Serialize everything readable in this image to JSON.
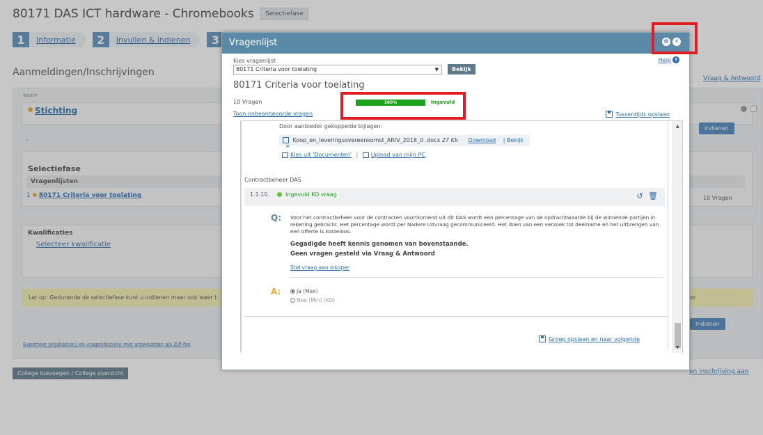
{
  "page": {
    "title": "80171 DAS ICT hardware - Chromebooks",
    "phase_button": "Selectiefase",
    "steps": [
      {
        "num": "1",
        "label": "Informatie"
      },
      {
        "num": "2",
        "label": "Invullen & indienen"
      },
      {
        "num": "3",
        "label": ""
      }
    ],
    "subtitle": "Aanmeldingen/Inschrijvingen",
    "right_link": "Vraag & Antwoord",
    "naam_header": "Naam",
    "org_name": "Stichting",
    "dash": "–",
    "selectiefase_title": "Selectiefase",
    "vragenlijsten_header": "Vragenlijsten",
    "vragenlijst_index": "1",
    "vragenlijst_name": "80171 Criteria voor toelating",
    "vragen_count": "10 Vragen",
    "kwalificaties_header": "Kwalificaties",
    "kwalificatie_link": "Selecteer kwalificatie",
    "note": "Let op: Gedurende de selectiefase kunt u indienen maar ook weer t",
    "note_end": "er.",
    "indienen": "Indienen",
    "export": "Exporteer prijslijst(en) en vragenlijst(en) met antwoorden als ZIP-file",
    "collega_button": "Collega toevoegen / Collega overzicht",
    "bottom_right_link": "en inschrijving aan"
  },
  "modal": {
    "title": "Vragenlijst",
    "help": "Help",
    "kies_label": "Kies vragenlijst",
    "select_value": "80171 Criteria voor toelating",
    "bekijk": "Bekijk",
    "heading": "80171 Criteria voor toelating",
    "vragen": "10 Vragen",
    "progress": {
      "percent": 100,
      "label": "100%"
    },
    "status": "Ingevuld",
    "toon_link": "Toon onbeantwoorde vragen",
    "tussentijds": "Tussentijds opslaan",
    "attachments_label": "Door aanbieder gekoppelde bijlagen:",
    "file_name": "Koop_en_leveringsovereenkomst_ARIV_2018_0 .docx",
    "file_size": "27 Kb",
    "download": "Download",
    "bekijk_link": "| Bekijk",
    "kies_docs": "Kies uit 'Documenten'",
    "sep": "|",
    "upload": "Upload van mijn PC",
    "section": "Contractbeheer DAS",
    "question_num": "1.1.10.",
    "question_status": "Ingevuld",
    "question_type": "KO vraag",
    "q_label": "Q:",
    "q_text": "Voor het contractbeheer voor de contracten voortkomend uit dit DAS wordt een percentage van de opdrachtwaarde bij de winnende partijen in rekening gebracht. Het percentage wordt per Nadere Uitvraag gecommuniceerd. Het doen van een verzoek tot deelname en het uitbrengen van een offerte is kosteloos.",
    "q_bold1": "Gegadigde heeft kennis genomen van bovenstaande.",
    "q_bold2": "Geen vragen gesteld via Vraag & Antwoord",
    "stel_vraag": "Stel vraag aan inkoper",
    "a_label": "A:",
    "options": [
      "Ja (Max)",
      "Nee (Min) (KO)"
    ],
    "groep_opslaan": "Groep opslaan en naar volgende"
  },
  "colors": {
    "header_blue": "#5b8aa8",
    "progress_green": "#1da21d",
    "highlight_red": "#e01c24"
  }
}
